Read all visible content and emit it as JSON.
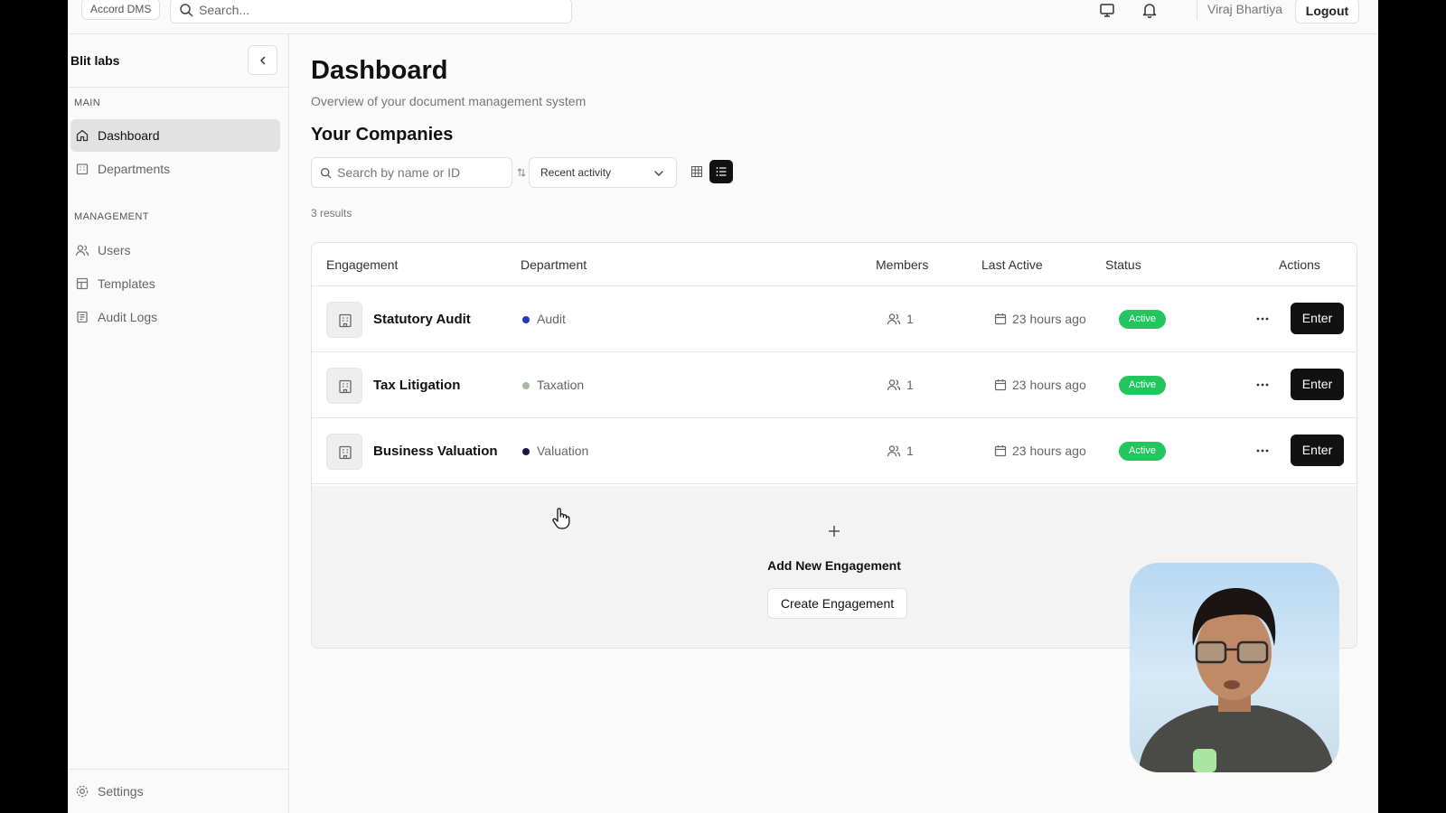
{
  "topbar": {
    "brand": "Accord DMS",
    "search_placeholder": "Search...",
    "user_name": "Viraj Bhartiya",
    "logout_label": "Logout"
  },
  "sidebar": {
    "org_name": "Blit labs",
    "main_label": "MAIN",
    "management_label": "MANAGEMENT",
    "items": [
      {
        "label": "Dashboard",
        "icon": "home-icon",
        "active": true
      },
      {
        "label": "Departments",
        "icon": "building-icon"
      },
      {
        "label": "Users",
        "icon": "users-icon"
      },
      {
        "label": "Templates",
        "icon": "template-icon"
      },
      {
        "label": "Audit Logs",
        "icon": "log-icon"
      }
    ],
    "settings_label": "Settings"
  },
  "main": {
    "title": "Dashboard",
    "subtitle": "Overview of your document management system",
    "section_title": "Your Companies",
    "search_placeholder": "Search by name or ID",
    "sort_value": "Recent activity",
    "results": "3 results",
    "columns": [
      "Engagement",
      "Department",
      "Members",
      "Last Active",
      "Status",
      "Actions"
    ],
    "rows": [
      {
        "engagement": "Statutory Audit",
        "department": "Audit",
        "dept_color": "#1d3bb8",
        "members": "1",
        "last_active": "23 hours ago",
        "status": "Active",
        "action": "Enter"
      },
      {
        "engagement": "Tax Litigation",
        "department": "Taxation",
        "dept_color": "#a7b7a3",
        "members": "1",
        "last_active": "23 hours ago",
        "status": "Active",
        "action": "Enter"
      },
      {
        "engagement": "Business Valuation",
        "department": "Valuation",
        "dept_color": "#161640",
        "members": "1",
        "last_active": "23 hours ago",
        "status": "Active",
        "action": "Enter"
      }
    ],
    "add_title": "Add New Engagement",
    "create_label": "Create Engagement"
  },
  "colors": {
    "accent": "#111111",
    "active_badge": "#22c55e"
  }
}
